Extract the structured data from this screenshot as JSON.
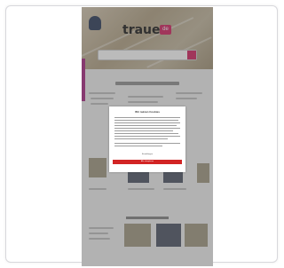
{
  "site": {
    "logo_text": "trauer",
    "logo_badge": "de"
  },
  "consent_modal": {
    "title": "Wir nutzen Cookies",
    "settings_label": "Einstellungen",
    "accept_label": "Alle akzeptieren"
  },
  "icons": [
    "crest-icon",
    "search-icon"
  ],
  "colors": {
    "accent": "#d6336c",
    "accept_button": "#d22424",
    "side_tab": "#b03a8c"
  }
}
